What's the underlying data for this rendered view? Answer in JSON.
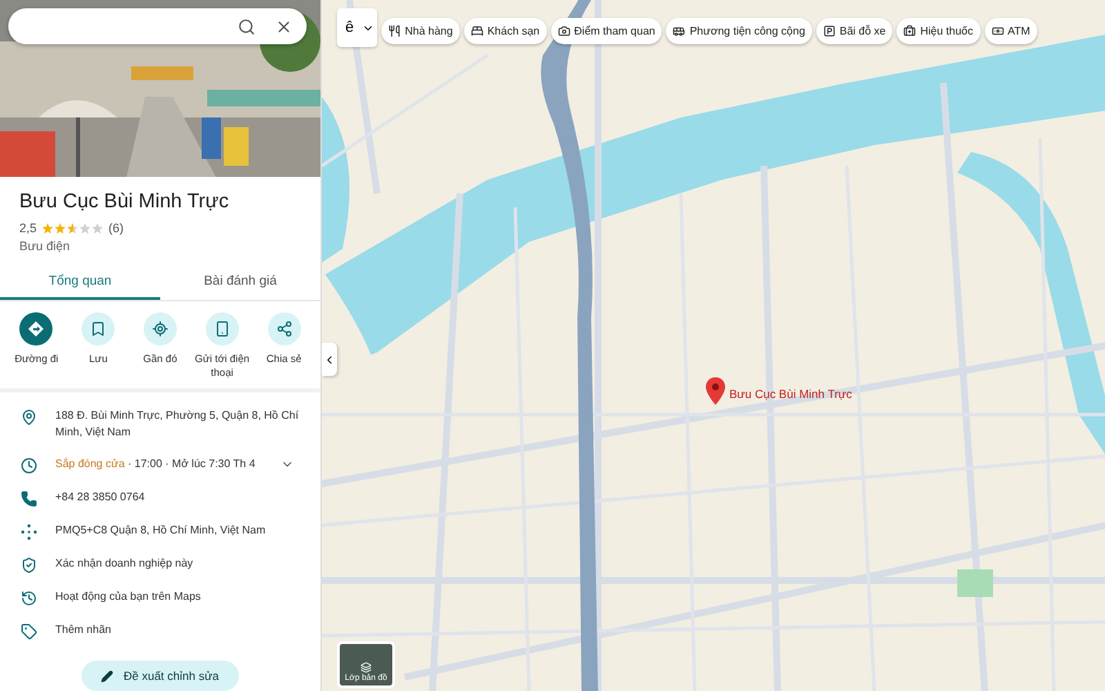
{
  "place": {
    "name": "Bưu Cục Bùi Minh Trực",
    "rating": "2,5",
    "stars": 2.5,
    "reviews": "(6)",
    "category": "Bưu điện"
  },
  "tabs": [
    {
      "label": "Tổng quan",
      "selected": true
    },
    {
      "label": "Bài đánh giá",
      "selected": false
    }
  ],
  "actions": [
    {
      "kind": "directions",
      "label": "Đường đi",
      "primary": true
    },
    {
      "kind": "save",
      "label": "Lưu",
      "primary": false
    },
    {
      "kind": "nearby",
      "label": "Gần đó",
      "primary": false
    },
    {
      "kind": "phone",
      "label": "Gửi tới điện thoại",
      "primary": false
    },
    {
      "kind": "share",
      "label": "Chia sẻ",
      "primary": false
    }
  ],
  "info": [
    {
      "kind": "address",
      "text": "188 Đ. Bùi Minh Trực, Phường 5, Quận 8, Hồ Chí Minh, Việt Nam"
    },
    {
      "kind": "hours",
      "status": "Sắp đóng cửa",
      "text": "· 17:00 · Mở lúc 7:30 Th 4",
      "expanded": false
    },
    {
      "kind": "phone",
      "text": "+84 28 3850 0764"
    },
    {
      "kind": "pluscode",
      "text": "PMQ5+C8 Quận 8, Hồ Chí Minh, Việt Nam"
    },
    {
      "kind": "verify",
      "text": "Xác nhận doanh nghiệp này"
    },
    {
      "kind": "activity",
      "text": "Hoạt động của bạn trên Maps"
    },
    {
      "kind": "label",
      "text": "Thêm nhãn"
    }
  ],
  "suggest_button": "Đề xuất chỉnh sửa",
  "map": {
    "input_tool": "ê",
    "chips": [
      {
        "kind": "restaurant",
        "label": "Nhà hàng"
      },
      {
        "kind": "hotel",
        "label": "Khách sạn"
      },
      {
        "kind": "attraction",
        "label": "Điểm tham quan"
      },
      {
        "kind": "transit",
        "label": "Phương tiện công cộng"
      },
      {
        "kind": "parking",
        "label": "Bãi đỗ xe"
      },
      {
        "kind": "pharmacy",
        "label": "Hiệu thuốc"
      },
      {
        "kind": "atm",
        "label": "ATM"
      }
    ],
    "marker_label": "Bưu Cục Bùi Minh Trực",
    "layers_label": "Lớp bản đồ"
  }
}
